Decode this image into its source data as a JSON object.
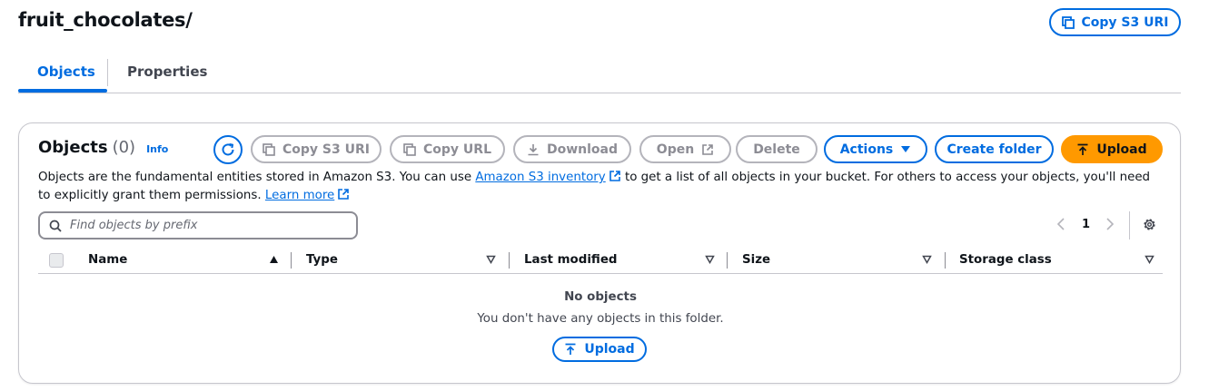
{
  "header": {
    "title": "fruit_chocolates/",
    "copy_s3_uri_label": "Copy S3 URI"
  },
  "tabs": [
    {
      "label": "Objects"
    },
    {
      "label": "Properties"
    }
  ],
  "objects_panel": {
    "heading": "Objects",
    "count": "(0)",
    "info_label": "Info",
    "toolbar": {
      "copy_s3_uri": "Copy S3 URI",
      "copy_url": "Copy URL",
      "download": "Download",
      "open": "Open",
      "delete": "Delete",
      "actions": "Actions",
      "create_folder": "Create folder",
      "upload": "Upload"
    },
    "description": {
      "before_link": "Objects are the fundamental entities stored in Amazon S3. You can use ",
      "inventory_link": "Amazon S3 inventory",
      "after_link": " to get a list of all objects in your bucket. For others to access your objects, you'll need to explicitly grant them permissions. ",
      "learn_more": "Learn more"
    },
    "search": {
      "placeholder": "Find objects by prefix",
      "value": ""
    },
    "pagination": {
      "current_page": "1"
    },
    "columns": [
      {
        "label": "Name"
      },
      {
        "label": "Type"
      },
      {
        "label": "Last modified"
      },
      {
        "label": "Size"
      },
      {
        "label": "Storage class"
      }
    ],
    "empty_state": {
      "title": "No objects",
      "message": "You don't have any objects in this folder.",
      "upload_label": "Upload"
    }
  },
  "colors": {
    "accent": "#006ce0",
    "upload_orange": "#ff9900",
    "disabled": "#8c8c94"
  }
}
